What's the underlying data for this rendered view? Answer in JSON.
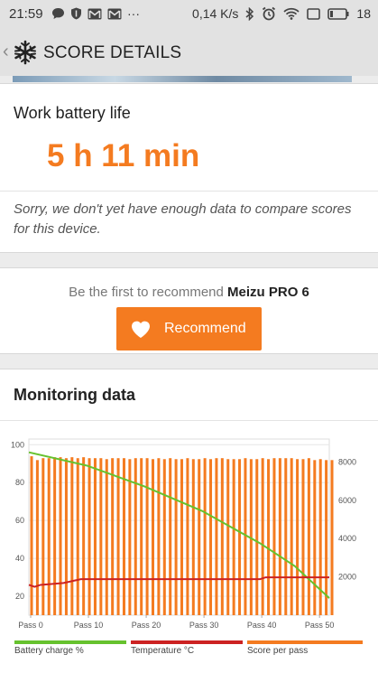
{
  "status_bar": {
    "time": "21:59",
    "network_speed": "0,14 K/s",
    "battery": "18",
    "left_icons": [
      "chat-icon",
      "shield-icon",
      "gmail-icon",
      "gmail-icon",
      "more-icon"
    ],
    "right_icons": [
      "bluetooth-icon",
      "alarm-icon",
      "wifi-icon",
      "sim-icon",
      "battery-icon"
    ]
  },
  "app_bar": {
    "title": "SCORE DETAILS",
    "back_icon": "chevron-left-icon",
    "logo_icon": "3dmark-snowflake-icon"
  },
  "battery_card": {
    "label": "Work battery life",
    "value": "5 h 11 min",
    "notice": "Sorry, we don't yet have enough data to compare scores for this device."
  },
  "recommend_card": {
    "prompt": "Be the first to recommend",
    "device": "Meizu PRO 6",
    "button_label": "Recommend",
    "button_icon": "heart-icon",
    "accent": "#f47b20"
  },
  "monitoring": {
    "heading": "Monitoring data"
  },
  "chart_data": {
    "type": "bar",
    "x_ticks": [
      "Pass 0",
      "Pass 10",
      "Pass 20",
      "Pass 30",
      "Pass 40",
      "Pass 50"
    ],
    "x_range": [
      0,
      52
    ],
    "y_left_ticks": [
      "100",
      "80",
      "60",
      "40",
      "20"
    ],
    "y_left_range": [
      10,
      103
    ],
    "y_right_ticks": [
      "8000",
      "6000",
      "4000",
      "2000"
    ],
    "y_right_range": [
      0,
      9200
    ],
    "grid": true,
    "legend_position": "bottom",
    "series": [
      {
        "name": "Battery charge %",
        "kind": "line",
        "axis": "left",
        "color": "#66c22e",
        "points": [
          [
            0,
            96
          ],
          [
            10,
            89
          ],
          [
            20,
            78
          ],
          [
            30,
            65
          ],
          [
            40,
            48
          ],
          [
            46,
            36
          ],
          [
            52,
            19
          ]
        ]
      },
      {
        "name": "Temperature °C",
        "kind": "line",
        "axis": "left",
        "color": "#cc2222",
        "points": [
          [
            0,
            26
          ],
          [
            1,
            25
          ],
          [
            2,
            26
          ],
          [
            6,
            27
          ],
          [
            9,
            29
          ],
          [
            40,
            29
          ],
          [
            41,
            30
          ],
          [
            52,
            30
          ]
        ]
      },
      {
        "name": "Score per pass",
        "kind": "bar",
        "axis": "right",
        "color": "#f47b20",
        "values": [
          8300,
          8100,
          8200,
          8200,
          8250,
          8250,
          8200,
          8250,
          8200,
          8250,
          8200,
          8200,
          8200,
          8150,
          8200,
          8200,
          8200,
          8150,
          8200,
          8200,
          8200,
          8150,
          8200,
          8150,
          8200,
          8150,
          8150,
          8200,
          8150,
          8150,
          8200,
          8150,
          8200,
          8200,
          8150,
          8150,
          8150,
          8200,
          8150,
          8150,
          8200,
          8150,
          8200,
          8200,
          8200,
          8200,
          8150,
          8150,
          8200,
          8100,
          8150,
          8100,
          8100
        ]
      }
    ]
  }
}
